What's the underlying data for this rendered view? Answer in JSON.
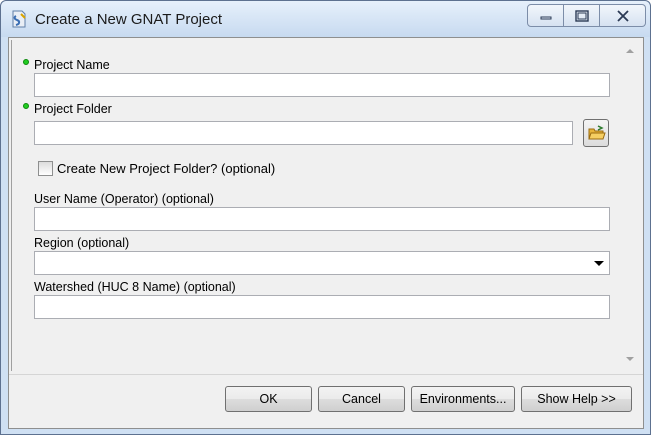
{
  "window": {
    "title": "Create a New GNAT Project",
    "app_icon": "arcgis-toolbox-icon"
  },
  "caption_buttons": {
    "minimize": "minimize-icon",
    "maximize": "maximize-icon",
    "close": "close-icon"
  },
  "form": {
    "project_name": {
      "label": "Project Name",
      "value": "",
      "required": true
    },
    "project_folder": {
      "label": "Project Folder",
      "value": "",
      "required": true,
      "browse_icon": "open-folder-icon"
    },
    "create_folder": {
      "label": "Create New Project Folder? (optional)",
      "checked": false
    },
    "user_name": {
      "label": "User Name (Operator) (optional)",
      "value": ""
    },
    "region": {
      "label": "Region (optional)",
      "selected": ""
    },
    "watershed": {
      "label": "Watershed (HUC 8 Name) (optional)",
      "value": ""
    }
  },
  "buttons": {
    "ok": "OK",
    "cancel": "Cancel",
    "environments": "Environments...",
    "show_help": "Show Help >>"
  },
  "colors": {
    "required_dot": "#22cc22",
    "title_bar": "#c7daf0",
    "dialog_bg": "#f0f0f0"
  }
}
